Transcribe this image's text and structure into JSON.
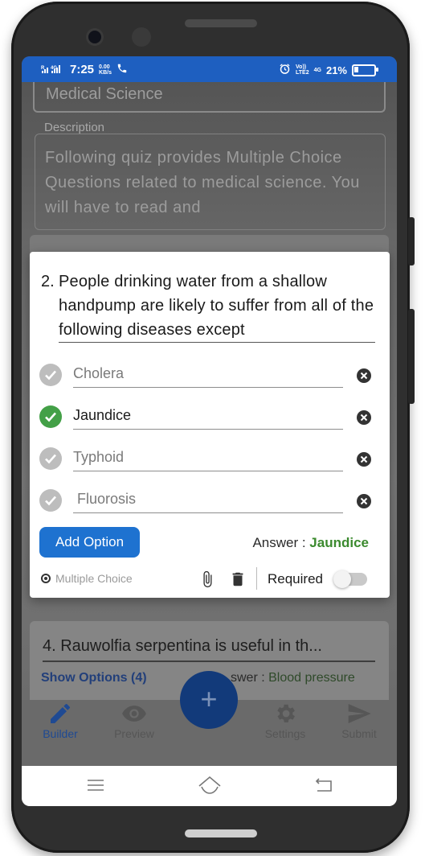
{
  "status_bar": {
    "carrier_left": "R",
    "time": "7:25",
    "net_speed": "0.00",
    "net_unit": "KB/s",
    "volte": "Vo))",
    "lte": "LTE2",
    "network": "4G",
    "battery": "21%",
    "battery_level": 0.21
  },
  "background": {
    "title_value": "Medical Science",
    "description_label": "Description",
    "description_text": "Following quiz provides Multiple Choice Questions related to medical science. You will have to read and",
    "question4": "4.  Rauwolfia serpentina is useful in th...",
    "show_options": "Show Options (4)",
    "answer_label": "swer : ",
    "answer_value": "Blood pressure"
  },
  "dialog": {
    "question_number": "2.",
    "question_text": "People drinking water from a shallow handpump are likely to suffer from all of the following diseases except",
    "options": [
      {
        "label": "Cholera",
        "selected": false
      },
      {
        "label": "Jaundice",
        "selected": true
      },
      {
        "label": "Typhoid",
        "selected": false
      },
      {
        "label": " Fluorosis",
        "selected": false
      }
    ],
    "add_option_label": "Add Option",
    "answer_label": "Answer : ",
    "answer_value": "Jaundice",
    "question_type": "Multiple Choice",
    "required_label": "Required",
    "required_on": false
  },
  "fab_label": "+",
  "bottom_nav": {
    "builder": "Builder",
    "preview": "Preview",
    "settings": "Settings",
    "submit": "Submit"
  },
  "colors": {
    "accent": "#1e72d0",
    "status_bar": "#1e5fc0",
    "correct": "#43a047",
    "answer_text": "#3b8a2e"
  }
}
